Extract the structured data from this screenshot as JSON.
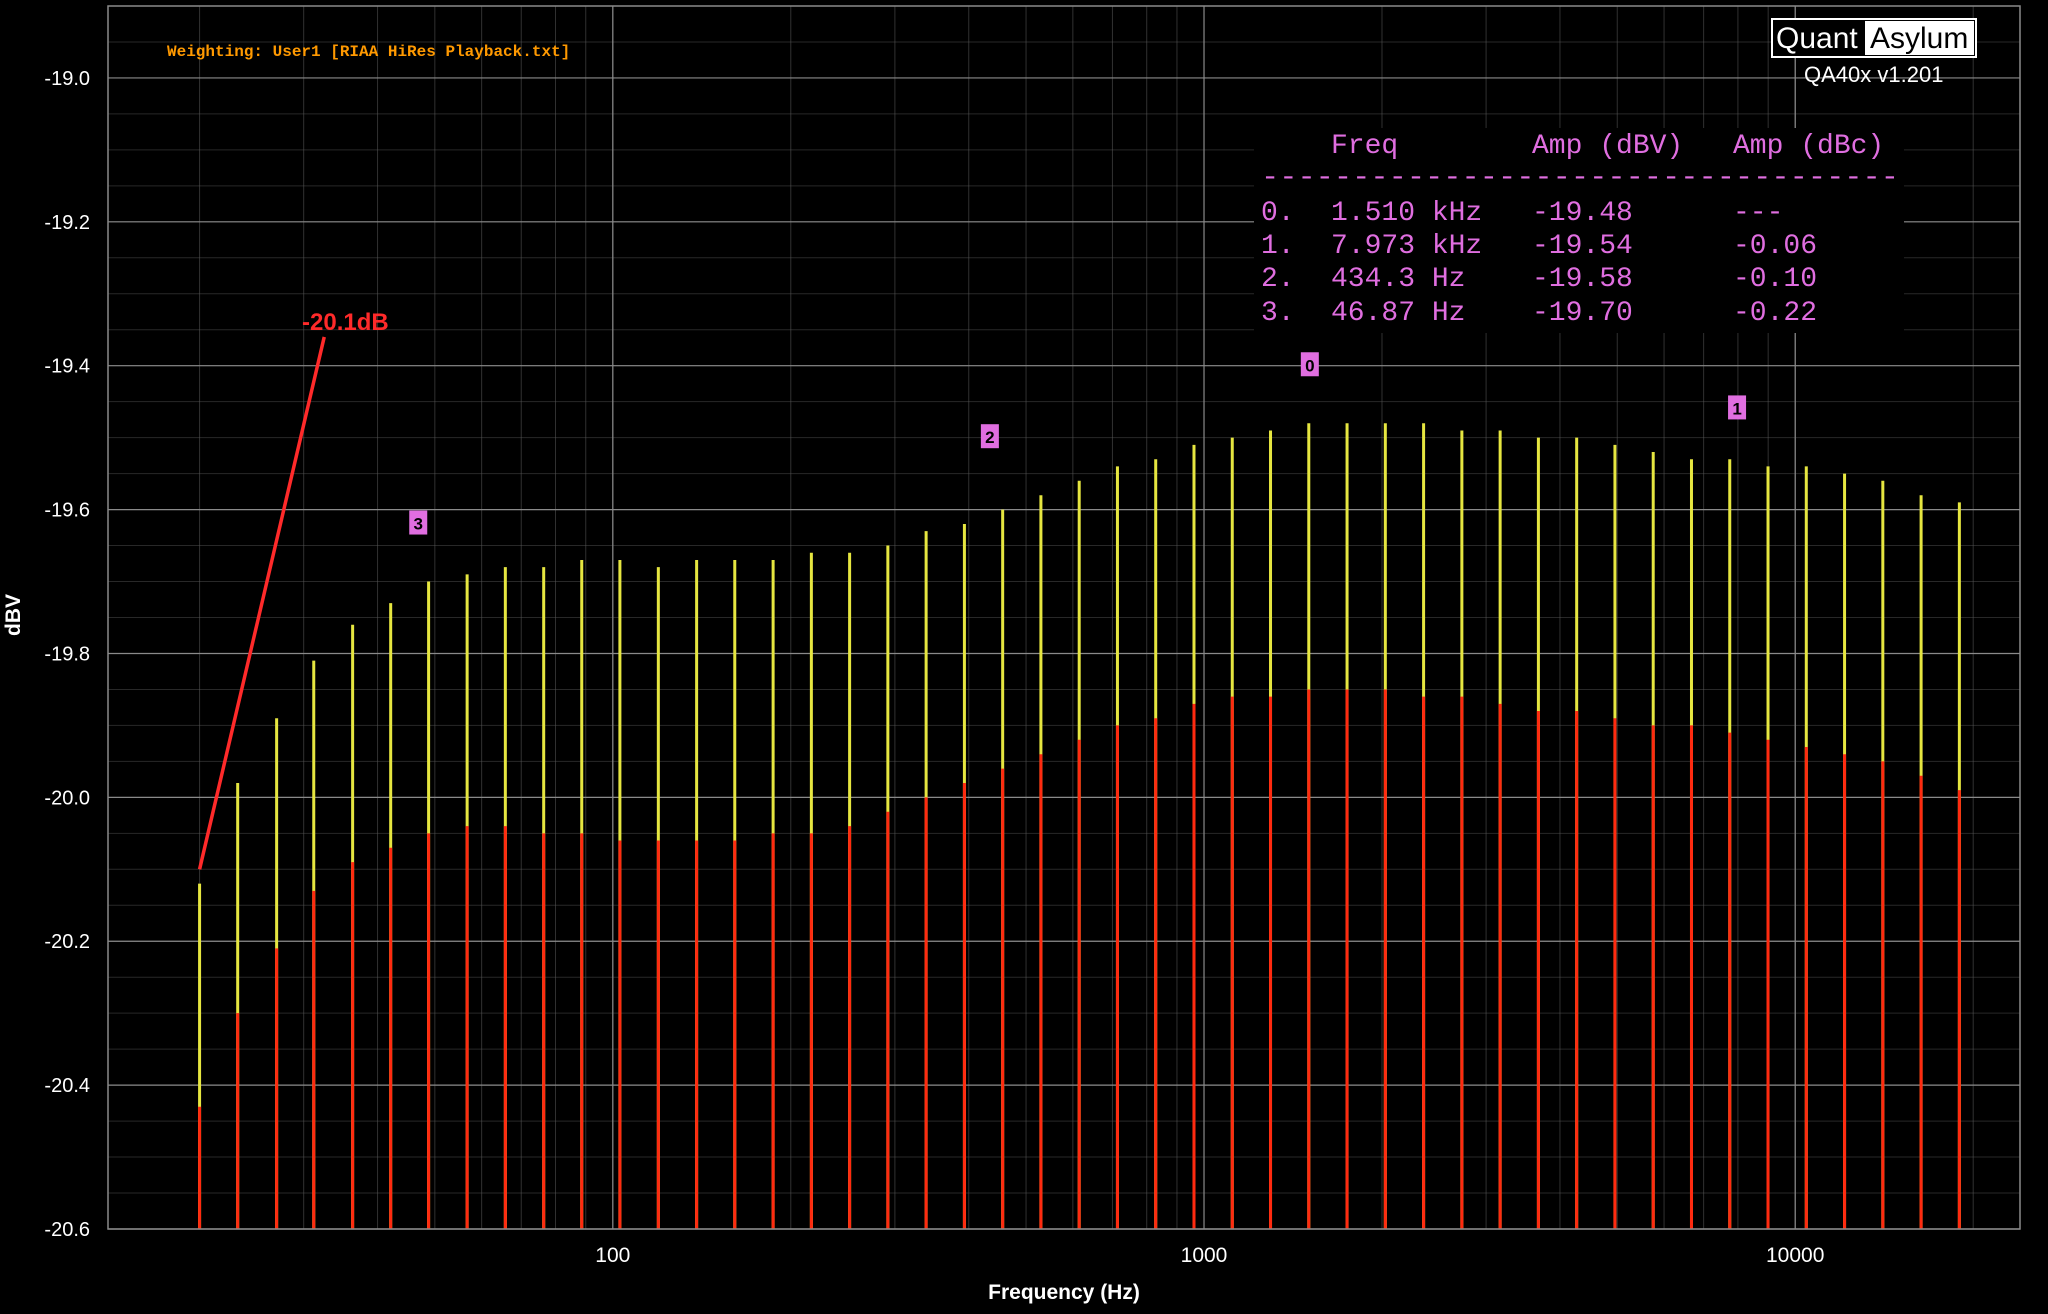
{
  "brand": {
    "quant": "Quant",
    "asylum": "Asylum",
    "version": "QA40x v1.201"
  },
  "weighting_label": "Weighting: User1 [RIAA HiRes Playback.txt]",
  "annotation": "-20.1dB",
  "colors": {
    "background": "#000000",
    "grid": "#5a5a5a",
    "upper_trace": "#e6e640",
    "lower_trace": "#ff2a10",
    "markers": "#e06ee0",
    "annotation": "#ff2a2a",
    "weighting": "#ff9900"
  },
  "table": {
    "headers": [
      "Freq",
      "Amp (dBV)",
      "Amp (dBc)"
    ],
    "divider": "-----------------------------------",
    "rows": [
      {
        "idx": "0.",
        "freq": "1.510 kHz",
        "amp_dbv": "-19.48",
        "amp_dbc": "---"
      },
      {
        "idx": "1.",
        "freq": "7.973 kHz",
        "amp_dbv": "-19.54",
        "amp_dbc": "-0.06"
      },
      {
        "idx": "2.",
        "freq": "434.3 Hz",
        "amp_dbv": "-19.58",
        "amp_dbc": "-0.10"
      },
      {
        "idx": "3.",
        "freq": "46.87 Hz",
        "amp_dbv": "-19.70",
        "amp_dbc": "-0.22"
      }
    ]
  },
  "chart_data": {
    "type": "bar",
    "xlabel": "Frequency (Hz)",
    "ylabel": "dBV",
    "x_scale": "log",
    "xlim": [
      14,
      24000
    ],
    "ylim": [
      -20.6,
      -18.9
    ],
    "x_ticks": [
      {
        "value": 100,
        "label": "100"
      },
      {
        "value": 1000,
        "label": "1000"
      },
      {
        "value": 10000,
        "label": "10000"
      }
    ],
    "y_ticks": [
      {
        "value": -19.0,
        "label": "-19.0"
      },
      {
        "value": -19.2,
        "label": "-19.2"
      },
      {
        "value": -19.4,
        "label": "-19.4"
      },
      {
        "value": -19.6,
        "label": "-19.6"
      },
      {
        "value": -19.8,
        "label": "-19.8"
      },
      {
        "value": -20.0,
        "label": "-20.0"
      },
      {
        "value": -20.2,
        "label": "-20.2"
      },
      {
        "value": -20.4,
        "label": "-20.4"
      },
      {
        "value": -20.6,
        "label": "-20.6"
      }
    ],
    "grid": true,
    "x": [
      20,
      23.2,
      27.0,
      31.2,
      36.3,
      42.1,
      48.8,
      56.7,
      65.8,
      76.4,
      88.6,
      102.8,
      119.4,
      138.6,
      160.8,
      186.7,
      216.7,
      251.5,
      291.9,
      338.8,
      393.3,
      456.5,
      529.8,
      615.0,
      713.8,
      828.5,
      961.7,
      1116.3,
      1295.7,
      1503.9,
      1745.6,
      2026.2,
      2351.9,
      2729.9,
      3168.7,
      3678.0,
      4269.1,
      4955.3,
      5751.8,
      6676.3,
      7749.3,
      8994.9,
      10440.6,
      12118.7,
      14066.6,
      16327.5,
      18951.8
    ],
    "series": [
      {
        "values": [
          -20.12,
          -19.98,
          -19.89,
          -19.81,
          -19.76,
          -19.73,
          -19.7,
          -19.69,
          -19.68,
          -19.68,
          -19.67,
          -19.67,
          -19.68,
          -19.67,
          -19.67,
          -19.67,
          -19.66,
          -19.66,
          -19.65,
          -19.63,
          -19.62,
          -19.6,
          -19.58,
          -19.56,
          -19.54,
          -19.53,
          -19.51,
          -19.5,
          -19.49,
          -19.48,
          -19.48,
          -19.48,
          -19.48,
          -19.49,
          -19.49,
          -19.5,
          -19.5,
          -19.51,
          -19.52,
          -19.53,
          -19.53,
          -19.54,
          -19.54,
          -19.55,
          -19.56,
          -19.58,
          -19.59
        ]
      },
      {
        "values": [
          -20.43,
          -20.3,
          -20.21,
          -20.13,
          -20.09,
          -20.07,
          -20.05,
          -20.04,
          -20.04,
          -20.05,
          -20.05,
          -20.06,
          -20.06,
          -20.06,
          -20.06,
          -20.05,
          -20.05,
          -20.04,
          -20.02,
          -20.0,
          -19.98,
          -19.96,
          -19.94,
          -19.92,
          -19.9,
          -19.89,
          -19.87,
          -19.86,
          -19.86,
          -19.85,
          -19.85,
          -19.85,
          -19.86,
          -19.86,
          -19.87,
          -19.88,
          -19.88,
          -19.89,
          -19.9,
          -19.9,
          -19.91,
          -19.92,
          -19.93,
          -19.94,
          -19.95,
          -19.97,
          -19.99
        ]
      }
    ],
    "markers": [
      {
        "label": "0",
        "x": 1510,
        "y": -19.48
      },
      {
        "label": "1",
        "x": 7973,
        "y": -19.54
      },
      {
        "label": "2",
        "x": 434.3,
        "y": -19.58
      },
      {
        "label": "3",
        "x": 46.87,
        "y": -19.7
      }
    ],
    "annotation_line": {
      "x1": 20,
      "y1": -20.1,
      "x2": 32.5,
      "y2": -19.36
    }
  }
}
